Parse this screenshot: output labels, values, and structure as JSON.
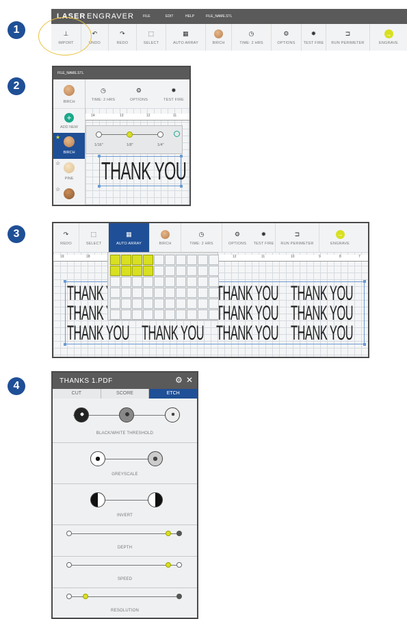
{
  "steps": [
    "1",
    "2",
    "3",
    "4"
  ],
  "p1": {
    "brand_a": "LASER",
    "brand_b": "ENGRAVER",
    "menu": [
      "FILE",
      "EDIT",
      "HELP",
      "FILE_NAME.STL"
    ],
    "tools": [
      "IMPORT",
      "UNDO",
      "REDO",
      "SELECT",
      "AUTO ARRAY",
      "BIRCH",
      "TIME: 2 HRS",
      "OPTIONS",
      "TEST FIRE",
      "RUN PERIMETER",
      "ENGRAVE"
    ]
  },
  "p2": {
    "file": "FILE_NAME.STL",
    "tools": [
      "BIRCH",
      "TIME: 2 HRS",
      "OPTIONS",
      "TEST FIRE"
    ],
    "sidebar": [
      "ADD NEW",
      "BIRCH",
      "PINE"
    ],
    "ruler": [
      "14",
      "13",
      "12",
      "11"
    ],
    "sizes": [
      "1/16\"",
      "1/8\"",
      "1/4\""
    ],
    "text": "THANK YOU"
  },
  "p3": {
    "tools": [
      "REDO",
      "SELECT",
      "AUTO ARRAY",
      "BIRCH",
      "TIME: 2 HRS",
      "OPTIONS",
      "TEST FIRE",
      "RUN PERIMETER",
      "ENGRAVE"
    ],
    "ruler": [
      "19",
      "18",
      "12",
      "11",
      "10",
      "9",
      "8",
      "7"
    ],
    "text": "THANK YOU"
  },
  "p4": {
    "title": "THANKS 1.PDF",
    "tabs": [
      "CUT",
      "SCORE",
      "ETCH"
    ],
    "active_tab": "ETCH",
    "sections": [
      "BLACK/WHITE THRESHOLD",
      "GREYSCALE",
      "INVERT",
      "DEPTH",
      "SPEED",
      "RESOLUTION"
    ]
  },
  "colors": {
    "accent": "#1f4f96",
    "highlight": "#d8e021",
    "toolbar_dark": "#5a5a5a"
  }
}
